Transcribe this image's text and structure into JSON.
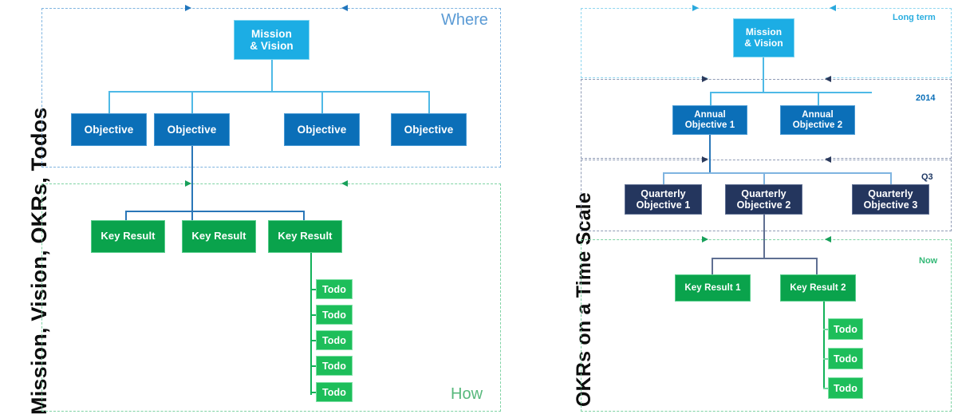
{
  "left_panel": {
    "title": "Mission, Vision, OKRs, Todos",
    "bands": [
      {
        "label": "Where",
        "color": "#5b9bd5"
      },
      {
        "label": "How",
        "color": "#57b87c"
      }
    ],
    "mission": {
      "line1": "Mission",
      "line2": "& Vision"
    },
    "objectives": [
      {
        "label": "Objective"
      },
      {
        "label": "Objective"
      },
      {
        "label": "Objective"
      },
      {
        "label": "Objective"
      }
    ],
    "key_results": [
      {
        "label": "Key Result"
      },
      {
        "label": "Key Result"
      },
      {
        "label": "Key Result"
      }
    ],
    "todos": [
      {
        "label": "Todo"
      },
      {
        "label": "Todo"
      },
      {
        "label": "Todo"
      },
      {
        "label": "Todo"
      },
      {
        "label": "Todo"
      }
    ]
  },
  "right_panel": {
    "title": "OKRs on a Time Scale",
    "bands": [
      {
        "label": "Long term",
        "color": "#2baee0"
      },
      {
        "label": "2014",
        "color": "#0b6fb8"
      },
      {
        "label": "Q3",
        "color": "#1f3864"
      },
      {
        "label": "Now",
        "color": "#35b978"
      }
    ],
    "mission": {
      "line1": "Mission",
      "line2": "& Vision"
    },
    "annual_objectives": [
      {
        "line1": "Annual",
        "line2": "Objective 1"
      },
      {
        "line1": "Annual",
        "line2": "Objective 2"
      }
    ],
    "quarterly_objectives": [
      {
        "line1": "Quarterly",
        "line2": "Objective 1"
      },
      {
        "line1": "Quarterly",
        "line2": "Objective 2"
      },
      {
        "line1": "Quarterly",
        "line2": "Objective 3"
      }
    ],
    "key_results": [
      {
        "label": "Key Result 1"
      },
      {
        "label": "Key Result 2"
      }
    ],
    "todos": [
      {
        "label": "Todo"
      },
      {
        "label": "Todo"
      },
      {
        "label": "Todo"
      }
    ]
  },
  "palette": {
    "mission_blue": "#1cade4",
    "objective_blue": "#0b6fb8",
    "quarterly_navy": "#24365e",
    "key_result_green": "#0aa34c",
    "todo_green": "#1dbe5a",
    "band_blue": "#7fb4e0",
    "band_green": "#7ed3a3"
  }
}
